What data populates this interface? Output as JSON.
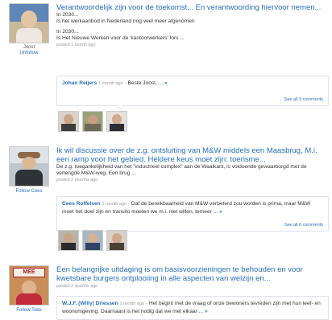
{
  "posts": [
    {
      "author": "Joost",
      "follow": "Unfollow",
      "title": "Verantwoordelijk zijn voor de toekomst... En verantwoording hiervoor nemen...",
      "lines": [
        "In 2030...",
        "Is het werkaanbod in Nederland nog veel meer afgenomen",
        "In 2030...",
        "Is Het Nieuwe Werken voor de 'kantoorwerkers' fors ..."
      ],
      "posted": "posted 1 month ago",
      "comment": {
        "name": "Johan Reijers",
        "time": "1 month ago",
        "text": "· Beste Joost, ...",
        "more": "»"
      },
      "see_all": "See all 3 comments"
    },
    {
      "author": "",
      "follow": "Follow Cees",
      "title": "Ik wil discussie over de z.g. ontsluiting van M&W middels een Maasbrug, M.i. een ramp voor het gebied. Heldere keus moet zijn: toerisme...",
      "lines": [
        "De z.g. toegankelijkheid van het \"industrieel complex\" aan de Waalkant, is voldoende gewaarborgd met de verlengde M&W-weg. Een brug ..."
      ],
      "posted": "posted 2 months ago",
      "comment": {
        "name": "Cees Roffelsen",
        "time": "1 month ago",
        "text": "· Dat de bereikbaarheid van M&W verbeterd zou worden is prima, maar M&W moet het doel zijn en transito moeten we m.i. niet willen, temeer ...",
        "more": "»"
      },
      "see_all": "See all 6 comments"
    },
    {
      "author": "",
      "follow": "Follow Toke",
      "title": "Een belangrijke uitdaging is om basisvoorzieningen te behouden en voor kwetsbare burgers ontplooiing in alle aspecten van welzijn en...",
      "lines": [],
      "posted": "posted 2 months ago",
      "comment": {
        "name": "W.J.F. (Willy) Driessen",
        "time": "1 month ago",
        "text": "· Het begint met de vraag of onze bewoners tevreden zijn met hun leef- en woonomgeving. Daarnaast is het nodig dat we met elkaar ...",
        "more": "»"
      },
      "see_all": ""
    }
  ],
  "avatar_sign": "MEE"
}
